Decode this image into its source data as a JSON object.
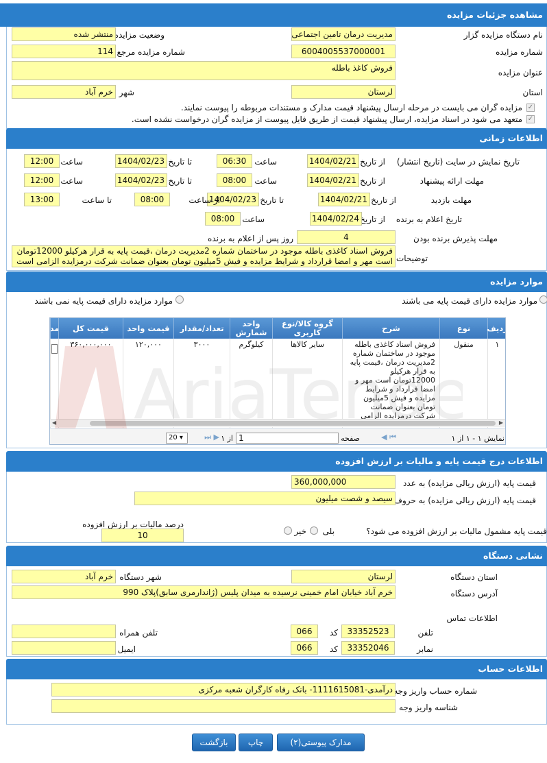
{
  "sections": {
    "details": "مشاهده جزئیات مزایده",
    "time": "اطلاعات زمانی",
    "items": "موارد مزایده",
    "price": "اطلاعات درج قیمت پایه و مالیات بر ارزش افزوده",
    "address": "نشانی دستگاه",
    "account": "اطلاعات حساب"
  },
  "details": {
    "org_label": "نام دستگاه مزایده گزار",
    "org_value": "مدیریت درمان تامین اجتماعی",
    "status_label": "وضعیت مزایده",
    "status_value": "منتشر شده",
    "number_label": "شماره مزایده",
    "number_value": "6004005537000001",
    "ref_label": "شماره مزایده مرجع",
    "ref_value": "114",
    "title_label": "عنوان مزایده",
    "title_value": "فروش کاغذ باطله",
    "province_label": "استان",
    "province_value": "لرستان",
    "city_label": "شهر",
    "city_value": "خرم آباد",
    "check1": "مزایده گران می بایست در مرحله ارسال پیشنهاد قیمت مدارک و مستندات مربوطه را پیوست نمایند.",
    "check2": "متعهد می شود در اسناد مزایده، ارسال پیشنهاد قیمت از طریق فایل پیوست از مزایده گران درخواست نشده است."
  },
  "time": {
    "display_label": "تاریخ نمایش در سایت (تاریخ انتشار)",
    "from": "از تاریخ",
    "to": "تا تاریخ",
    "hour": "ساعت",
    "to_hour": "تا ساعت",
    "from_hour": "از ساعت",
    "display_from": "1404/02/21",
    "display_from_time": "06:30",
    "display_to": "1404/02/23",
    "display_to_time": "12:00",
    "offer_label": "مهلت ارائه پیشنهاد",
    "offer_from": "1404/02/21",
    "offer_from_time": "08:00",
    "offer_to": "1404/02/23",
    "offer_to_time": "12:00",
    "visit_label": "مهلت بازدید",
    "visit_from": "1404/02/21",
    "visit_to": "1404/02/23",
    "visit_from_time": "08:00",
    "visit_to_time": "13:00",
    "winner_label": "تاریخ اعلام به برنده",
    "winner_date": "1404/02/24",
    "winner_time": "08:00",
    "accept_label": "مهلت پذیرش برنده بودن",
    "accept_days": "4",
    "accept_suffix": "روز پس از اعلام به برنده",
    "notes_label": "توضیحات",
    "notes_value": "فروش اسناد کاغذی باطله موجود در ساختمان شماره 2مدیریت درمان ،قیمت پایه به قرار هرکیلو 12000تومان است مهر و امضا قرارداد و شرایط مزایده و فیش 5میلیون تومان بعنوان ضمانت شرکت درمزایده الزامی است"
  },
  "items": {
    "opt_with": "موارد مزایده دارای قیمت پایه می باشند",
    "opt_without": "موارد مزایده دارای قیمت پایه نمی باشند",
    "columns": [
      "ردیف",
      "نوع",
      "شرح",
      "گروه کالا/نوع کاربری",
      "واحد شمارش",
      "تعداد/مقدار",
      "قیمت واحد",
      "قیمت کل",
      "مد"
    ],
    "row": {
      "idx": "۱",
      "type": "منقول",
      "desc": "فروش اسناد کاغذی باطله موجود در ساختمان شماره 2مدیریت درمان ،قیمت پایه به قرار هرکیلو 12000تومان است مهر و امضا قرارداد و شرایط مزایده و فیش 5میلیون تومان بعنوان ضمانت شرکت درمزایده الزامی است",
      "group": "سایر کالاها",
      "unit": "کیلوگرم",
      "qty": "۳۰۰۰",
      "unit_price": "۱۲۰,۰۰۰",
      "total": "۳۶۰,۰۰۰,۰۰۰"
    },
    "pager_show": "نمایش ۱ - ۱ از ۱",
    "pager_page": "صفحه",
    "pager_page_value": "1",
    "pager_of": "از ۱",
    "pager_size": "20",
    "watermark": "AriaTender"
  },
  "price": {
    "base_num_label": "قیمت پایه (ارزش ریالی مزایده) به عدد",
    "base_num": "360,000,000",
    "base_words_label": "قیمت پایه (ارزش ریالی مزایده) به حروف",
    "base_words": "سیصد و شصت میلیون",
    "vat_q": "قیمت پایه مشمول مالیات بر ارزش افزوده می شود؟",
    "yes": "بلی",
    "no": "خیر",
    "vat_pct_label": "درصد مالیات بر ارزش افزوده",
    "vat_pct": "10"
  },
  "address": {
    "province_label": "استان دستگاه",
    "province": "لرستان",
    "city_label": "شهر دستگاه",
    "city": "خرم آباد",
    "addr_label": "آدرس دستگاه",
    "addr": "خرم آباد خیابان امام خمینی نرسیده به میدان پلیس (ژاندارمری سابق)پلاک 990",
    "contact": "اطلاعات تماس",
    "phone_label": "تلفن",
    "phone": "33352523",
    "code_label": "کد",
    "code": "066",
    "mobile_label": "تلفن همراه",
    "fax_label": "نمابر",
    "fax": "33352046",
    "fax_code": "066",
    "email_label": "ایمیل"
  },
  "account": {
    "acc_label": "شماره حساب واریز وجه",
    "acc_value": "درآمدی-1111615081- بانک رفاه کارگران شعبه مرکزی",
    "id_label": "شناسه واریز وجه"
  },
  "buttons": {
    "docs": "مدارک پیوستی(۲)",
    "print": "چاپ",
    "back": "بازگشت"
  },
  "colors": {
    "header": "#2b7fcb",
    "field": "#ffffa6"
  }
}
